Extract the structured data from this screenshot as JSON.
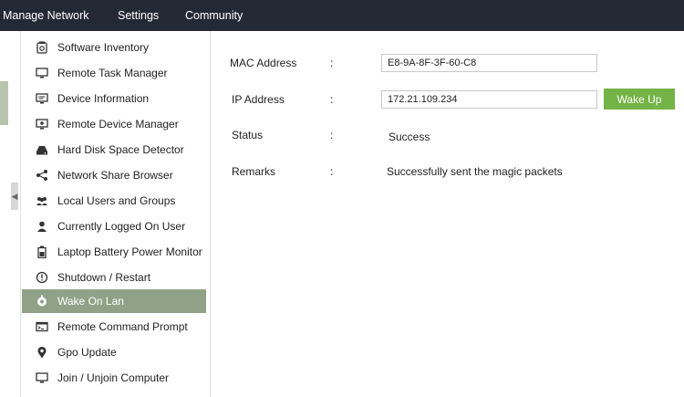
{
  "topnav": {
    "items": [
      {
        "label": "Manage Network"
      },
      {
        "label": "Settings"
      },
      {
        "label": "Community"
      }
    ]
  },
  "sidebar": {
    "items": [
      {
        "label": "Software Inventory",
        "icon": "software-inventory-icon"
      },
      {
        "label": "Remote Task Manager",
        "icon": "monitor-icon"
      },
      {
        "label": "Device Information",
        "icon": "monitor-info-icon"
      },
      {
        "label": "Remote Device Manager",
        "icon": "monitor-device-icon"
      },
      {
        "label": "Hard Disk Space Detector",
        "icon": "hard-disk-icon"
      },
      {
        "label": "Network Share Browser",
        "icon": "share-icon"
      },
      {
        "label": "Local Users and Groups",
        "icon": "users-group-icon"
      },
      {
        "label": "Currently Logged On User",
        "icon": "user-icon"
      },
      {
        "label": "Laptop Battery Power Monitor",
        "icon": "battery-icon"
      },
      {
        "label": "Shutdown / Restart",
        "icon": "power-icon"
      },
      {
        "label": "Wake On Lan",
        "icon": "wake-on-lan-icon",
        "active": true
      },
      {
        "label": "Remote Command Prompt",
        "icon": "command-prompt-icon"
      },
      {
        "label": "Gpo Update",
        "icon": "location-pin-icon"
      },
      {
        "label": "Join / Unjoin Computer",
        "icon": "computer-icon"
      }
    ]
  },
  "form": {
    "mac": {
      "label": "MAC Address",
      "colon": ":",
      "value": "E8-9A-8F-3F-60-C8"
    },
    "ip": {
      "label": "IP Address",
      "colon": ":",
      "value": "172.21.109.234"
    },
    "status": {
      "label": "Status",
      "colon": ":",
      "value": "Success"
    },
    "remarks": {
      "label": "Remarks",
      "colon": ":",
      "value": "Successfully sent the magic packets"
    },
    "wake_button": "Wake Up"
  },
  "colors": {
    "topbar": "#232a36",
    "active_item": "#8fa287",
    "button": "#74b346"
  }
}
